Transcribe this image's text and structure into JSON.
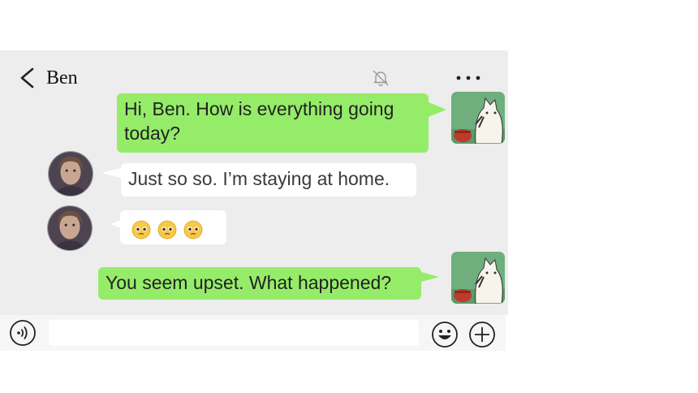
{
  "header": {
    "title": "Ben",
    "back_icon": "chevron-left-icon",
    "mute_icon": "bell-off-icon",
    "more_icon": "more-dots-icon"
  },
  "messages": [
    {
      "sender": "me",
      "text_line1": "Hi, Ben. How is everything going",
      "text_line2": "today?"
    },
    {
      "sender": "Ben",
      "text": "Just so so. I’m staying at home."
    },
    {
      "sender": "Ben",
      "emoji": [
        "pleading-face",
        "pleading-face",
        "pleading-face"
      ]
    },
    {
      "sender": "me",
      "text": "You seem upset. What happened?"
    }
  ],
  "composer": {
    "value": "",
    "voice_icon": "voice-icon",
    "emoji_icon": "smiley-icon",
    "plus_icon": "plus-circle-icon"
  },
  "colors": {
    "chat_bg": "#ededed",
    "outgoing_bubble": "#95ec69",
    "incoming_bubble": "#ffffff",
    "composer_bg": "#f6f6f6"
  }
}
